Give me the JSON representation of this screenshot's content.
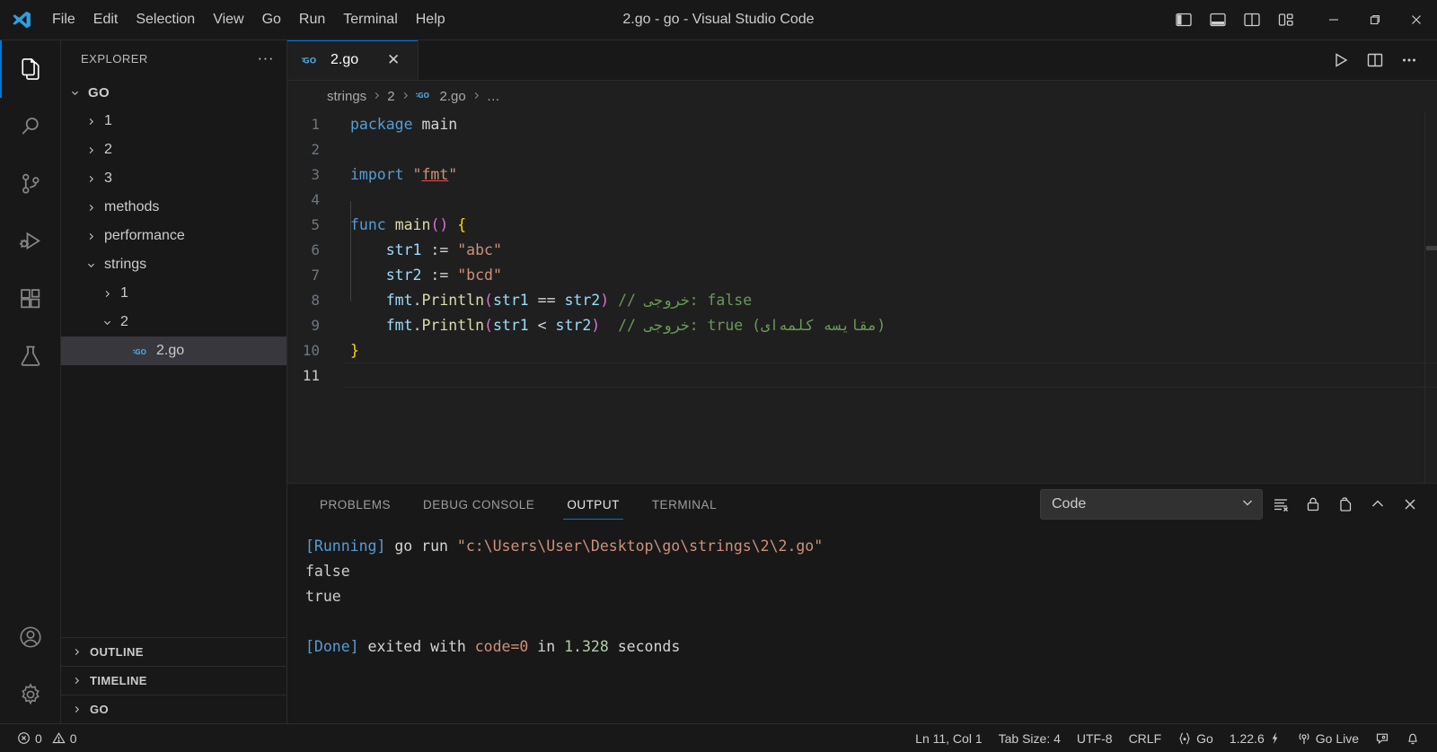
{
  "window": {
    "title": "2.go - go - Visual Studio Code",
    "menus": [
      "File",
      "Edit",
      "Selection",
      "View",
      "Go",
      "Run",
      "Terminal",
      "Help"
    ],
    "layout_buttons": [
      "toggle-primary-sidebar",
      "toggle-panel",
      "toggle-secondary-sidebar",
      "customize-layout"
    ],
    "controls": {
      "minimize": "—",
      "maximize": "❐",
      "close": "✕"
    }
  },
  "activitybar": {
    "items": [
      {
        "name": "explorer",
        "active": true
      },
      {
        "name": "search",
        "active": false
      },
      {
        "name": "source-control",
        "active": false
      },
      {
        "name": "run-and-debug",
        "active": false
      },
      {
        "name": "extensions",
        "active": false
      },
      {
        "name": "testing",
        "active": false
      }
    ],
    "bottom": [
      {
        "name": "accounts"
      },
      {
        "name": "manage-settings"
      }
    ]
  },
  "sidebar": {
    "title": "EXPLORER",
    "more_actions": "···",
    "tree": [
      {
        "label": "GO",
        "indent": 0,
        "twisty": "down",
        "type": "root",
        "selected": false
      },
      {
        "label": "1",
        "indent": 1,
        "twisty": "right",
        "type": "folder",
        "selected": false
      },
      {
        "label": "2",
        "indent": 1,
        "twisty": "right",
        "type": "folder",
        "selected": false
      },
      {
        "label": "3",
        "indent": 1,
        "twisty": "right",
        "type": "folder",
        "selected": false
      },
      {
        "label": "methods",
        "indent": 1,
        "twisty": "right",
        "type": "folder",
        "selected": false
      },
      {
        "label": "performance",
        "indent": 1,
        "twisty": "right",
        "type": "folder",
        "selected": false
      },
      {
        "label": "strings",
        "indent": 1,
        "twisty": "down",
        "type": "folder",
        "selected": false
      },
      {
        "label": "1",
        "indent": 2,
        "twisty": "right",
        "type": "folder",
        "selected": false
      },
      {
        "label": "2",
        "indent": 2,
        "twisty": "down",
        "type": "folder",
        "selected": false
      },
      {
        "label": "2.go",
        "indent": 3,
        "twisty": "none",
        "type": "gofile",
        "selected": true
      }
    ],
    "sections": [
      "OUTLINE",
      "TIMELINE",
      "GO"
    ]
  },
  "editor": {
    "tab": {
      "label": "2.go",
      "icon": "go-icon",
      "close": "✕"
    },
    "actions": [
      "run-code-button",
      "split-editor-right-button",
      "more-actions-button"
    ],
    "breadcrumbs": [
      "strings",
      "2",
      "2.go",
      "…"
    ],
    "cursor_line": 11,
    "lines": [
      {
        "n": 1,
        "tokens": [
          {
            "t": "package",
            "c": "kw"
          },
          {
            "t": " ",
            "c": "plain"
          },
          {
            "t": "main",
            "c": "plain"
          }
        ]
      },
      {
        "n": 2,
        "tokens": []
      },
      {
        "n": 3,
        "tokens": [
          {
            "t": "import",
            "c": "kw"
          },
          {
            "t": " ",
            "c": "plain"
          },
          {
            "t": "\"",
            "c": "str"
          },
          {
            "t": "fmt",
            "c": "str err-underline"
          },
          {
            "t": "\"",
            "c": "str"
          }
        ]
      },
      {
        "n": 4,
        "tokens": []
      },
      {
        "n": 5,
        "tokens": [
          {
            "t": "func",
            "c": "kw"
          },
          {
            "t": " ",
            "c": "plain"
          },
          {
            "t": "main",
            "c": "fn"
          },
          {
            "t": "()",
            "c": "paren2"
          },
          {
            "t": " ",
            "c": "plain"
          },
          {
            "t": "{",
            "c": "paren"
          }
        ]
      },
      {
        "n": 6,
        "tokens": [
          {
            "t": "    ",
            "c": "plain"
          },
          {
            "t": "str1",
            "c": "var"
          },
          {
            "t": " := ",
            "c": "op"
          },
          {
            "t": "\"abc\"",
            "c": "str"
          }
        ]
      },
      {
        "n": 7,
        "tokens": [
          {
            "t": "    ",
            "c": "plain"
          },
          {
            "t": "str2",
            "c": "var"
          },
          {
            "t": " := ",
            "c": "op"
          },
          {
            "t": "\"bcd\"",
            "c": "str"
          }
        ]
      },
      {
        "n": 8,
        "tokens": [
          {
            "t": "    ",
            "c": "plain"
          },
          {
            "t": "fmt",
            "c": "var"
          },
          {
            "t": ".",
            "c": "plain"
          },
          {
            "t": "Println",
            "c": "fn"
          },
          {
            "t": "(",
            "c": "paren2"
          },
          {
            "t": "str1",
            "c": "var"
          },
          {
            "t": " == ",
            "c": "op"
          },
          {
            "t": "str2",
            "c": "var"
          },
          {
            "t": ")",
            "c": "paren2"
          },
          {
            "t": " // خروجی: false",
            "c": "cmt"
          }
        ]
      },
      {
        "n": 9,
        "tokens": [
          {
            "t": "    ",
            "c": "plain"
          },
          {
            "t": "fmt",
            "c": "var"
          },
          {
            "t": ".",
            "c": "plain"
          },
          {
            "t": "Println",
            "c": "fn"
          },
          {
            "t": "(",
            "c": "paren2"
          },
          {
            "t": "str1",
            "c": "var"
          },
          {
            "t": " < ",
            "c": "op"
          },
          {
            "t": "str2",
            "c": "var"
          },
          {
            "t": ")",
            "c": "paren2"
          },
          {
            "t": "  // خروجی: true (مقایسه کلمه‌ای)",
            "c": "cmt"
          }
        ]
      },
      {
        "n": 10,
        "tokens": [
          {
            "t": "}",
            "c": "paren"
          }
        ]
      },
      {
        "n": 11,
        "tokens": []
      }
    ]
  },
  "panel": {
    "tabs": [
      {
        "label": "PROBLEMS",
        "active": false
      },
      {
        "label": "DEBUG CONSOLE",
        "active": false
      },
      {
        "label": "OUTPUT",
        "active": true
      },
      {
        "label": "TERMINAL",
        "active": false
      }
    ],
    "channel_select": {
      "value": "Code",
      "chevron": "⌄"
    },
    "actions": [
      "clear-output-button",
      "turn-auto-scrolling-off-button",
      "open-output-in-editor-button",
      "maximize-panel-button",
      "close-panel-button"
    ],
    "output_lines": [
      [
        {
          "t": "[Running]",
          "c": "o-tag"
        },
        {
          "t": " go run ",
          "c": "o-cmd"
        },
        {
          "t": "\"c:\\Users\\User\\Desktop\\go\\strings\\2\\2.go\"",
          "c": "o-path"
        }
      ],
      [
        {
          "t": "false",
          "c": "o-val"
        }
      ],
      [
        {
          "t": "true",
          "c": "o-val"
        }
      ],
      [],
      [
        {
          "t": "[Done]",
          "c": "o-done"
        },
        {
          "t": " exited with ",
          "c": "o-cmd"
        },
        {
          "t": "code=0",
          "c": "o-code"
        },
        {
          "t": " in ",
          "c": "o-cmd"
        },
        {
          "t": "1.328",
          "c": "o-num"
        },
        {
          "t": " seconds",
          "c": "o-cmd"
        }
      ]
    ]
  },
  "statusbar": {
    "errors": "0",
    "warnings": "0",
    "position": "Ln 11, Col 1",
    "indentation": "Tab Size: 4",
    "encoding": "UTF-8",
    "eol": "CRLF",
    "language": "Go",
    "go_version": "1.22.6",
    "go_live": "Go Live",
    "remote": "remote-indicator",
    "bell": "notifications"
  },
  "colors": {
    "accent": "#0078d4",
    "titlebar_bg": "#181818",
    "editor_bg": "#1f1f1f",
    "sidebar_bg": "#181818",
    "selected_row": "#37373d",
    "comment_green": "#6a9955",
    "string_orange": "#ce9178",
    "keyword_blue": "#569cd6"
  }
}
